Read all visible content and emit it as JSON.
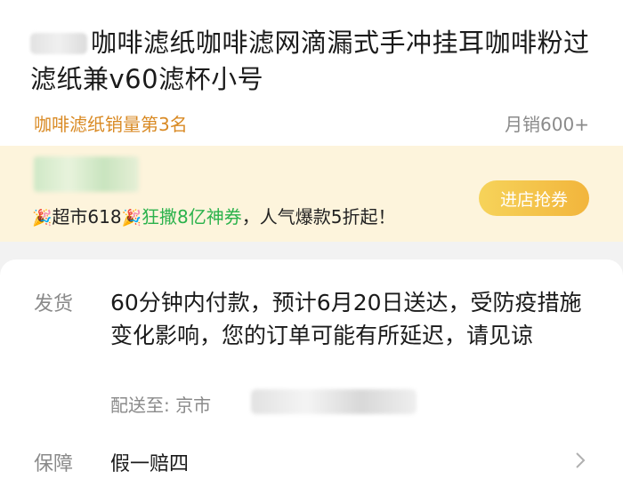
{
  "product": {
    "title": "咖啡滤纸咖啡滤网滴漏式手冲挂耳咖啡粉过滤纸兼v60滤杯小号",
    "rank": "咖啡滤纸销量第3名",
    "monthly_sales": "月销600+"
  },
  "store": {
    "promo_prefix": "超市618",
    "promo_highlight": "狂撒8亿神券",
    "promo_suffix": "，人气爆款5折起！",
    "button_label": "进店抢券"
  },
  "shipping": {
    "label": "发货",
    "text": "60分钟内付款，预计6月20日送达，受防疫措施变化影响，您的订单可能有所延迟，请见谅",
    "address_prefix": "配送至:",
    "address_city": "京市"
  },
  "guarantee": {
    "label": "保障",
    "text": "假一赔四"
  },
  "colors": {
    "accent_orange": "#d98a24",
    "promo_green": "#2bb24c",
    "button_yellow": "#f2b53c",
    "band_bg": "#fdf4dc"
  }
}
